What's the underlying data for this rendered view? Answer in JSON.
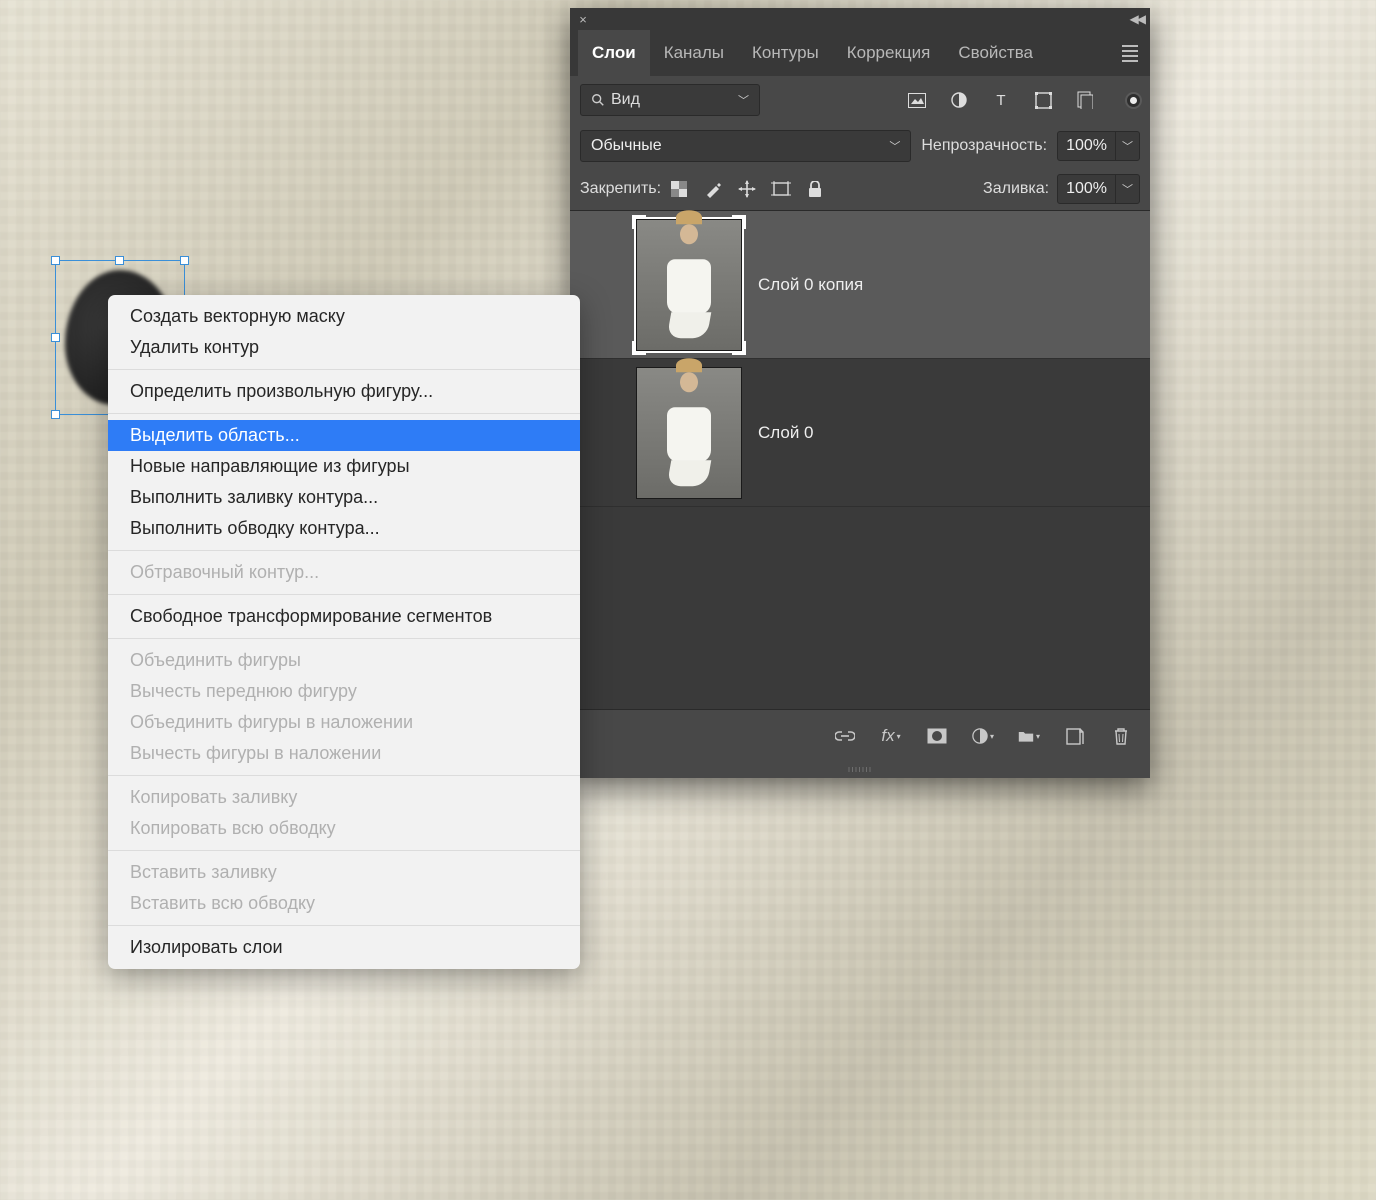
{
  "panel": {
    "tabs": [
      "Слои",
      "Каналы",
      "Контуры",
      "Коррекция",
      "Свойства"
    ],
    "active_tab": 0,
    "search_label": "Вид",
    "blend_mode": "Обычные",
    "opacity_label": "Непрозрачность:",
    "opacity_value": "100%",
    "lock_label": "Закрепить:",
    "fill_label": "Заливка:",
    "fill_value": "100%",
    "layers": [
      {
        "name": "Слой 0 копия",
        "selected": true
      },
      {
        "name": "Слой 0",
        "selected": false
      }
    ]
  },
  "context_menu": {
    "groups": [
      [
        {
          "label": "Создать векторную маску",
          "enabled": true
        },
        {
          "label": "Удалить контур",
          "enabled": true
        }
      ],
      [
        {
          "label": "Определить произвольную фигуру...",
          "enabled": true
        }
      ],
      [
        {
          "label": "Выделить область...",
          "enabled": true,
          "highlighted": true
        },
        {
          "label": "Новые направляющие из фигуры",
          "enabled": true
        },
        {
          "label": "Выполнить заливку контура...",
          "enabled": true
        },
        {
          "label": "Выполнить обводку контура...",
          "enabled": true
        }
      ],
      [
        {
          "label": "Обтравочный контур...",
          "enabled": false
        }
      ],
      [
        {
          "label": "Свободное трансформирование сегментов",
          "enabled": true
        }
      ],
      [
        {
          "label": "Объединить фигуры",
          "enabled": false
        },
        {
          "label": "Вычесть переднюю фигуру",
          "enabled": false
        },
        {
          "label": "Объединить фигуры в наложении",
          "enabled": false
        },
        {
          "label": "Вычесть фигуры в наложении",
          "enabled": false
        }
      ],
      [
        {
          "label": "Копировать заливку",
          "enabled": false
        },
        {
          "label": "Копировать всю обводку",
          "enabled": false
        }
      ],
      [
        {
          "label": "Вставить заливку",
          "enabled": false
        },
        {
          "label": "Вставить всю обводку",
          "enabled": false
        }
      ],
      [
        {
          "label": "Изолировать слои",
          "enabled": true
        }
      ]
    ]
  }
}
